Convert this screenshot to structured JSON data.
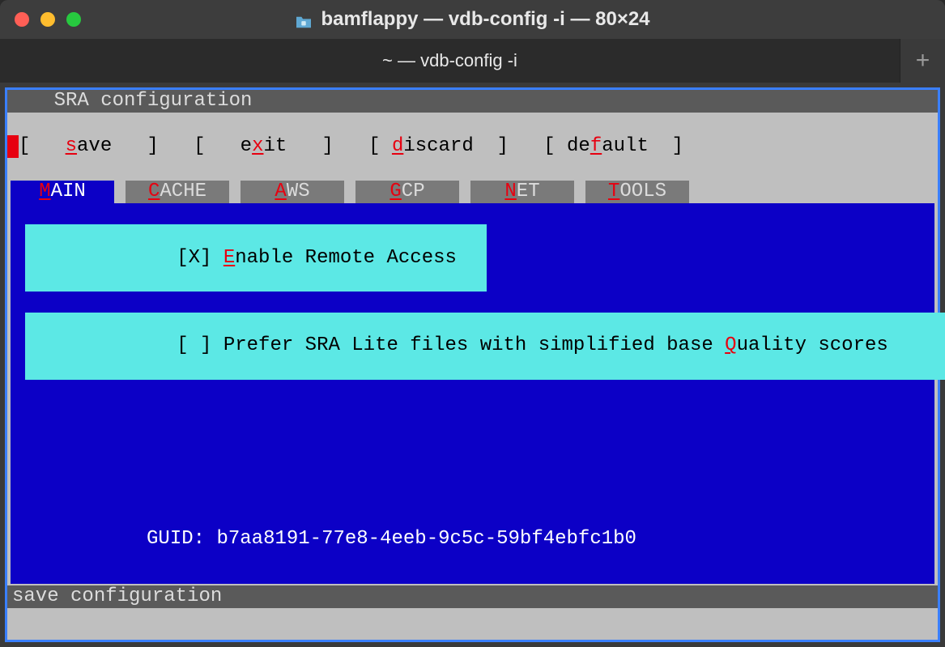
{
  "window": {
    "title": "bamflappy — vdb-config -i — 80×24"
  },
  "tabbar": {
    "active": "~ — vdb-config -i"
  },
  "header": {
    "title": "SRA configuration"
  },
  "buttons": {
    "save": {
      "hot": "s",
      "rest": "ave"
    },
    "exit": {
      "pre": "e",
      "hot": "x",
      "rest": "it"
    },
    "discard": {
      "hot": "d",
      "rest": "iscard"
    },
    "default": {
      "pre": "de",
      "hot": "f",
      "rest": "ault"
    }
  },
  "tabs": {
    "main": {
      "hot": "M",
      "rest": "AIN"
    },
    "cache": {
      "hot": "C",
      "rest": "ACHE"
    },
    "aws": {
      "hot": "A",
      "rest": "WS"
    },
    "gcp": {
      "hot": "G",
      "rest": "CP"
    },
    "net": {
      "hot": "N",
      "rest": "ET"
    },
    "tools": {
      "hot": "T",
      "rest": "OOLS"
    }
  },
  "options": {
    "enable_remote": {
      "state": "[X] ",
      "hot": "E",
      "rest": "nable Remote Access  "
    },
    "prefer_lite": {
      "state": "[ ] ",
      "pre": "Prefer SRA Lite files with simplified base ",
      "hot": "Q",
      "rest": "uality scores              "
    }
  },
  "guid": {
    "label": "GUID: ",
    "value": "b7aa8191-77e8-4eeb-9c5c-59bf4ebfc1b0"
  },
  "status": "save configuration"
}
